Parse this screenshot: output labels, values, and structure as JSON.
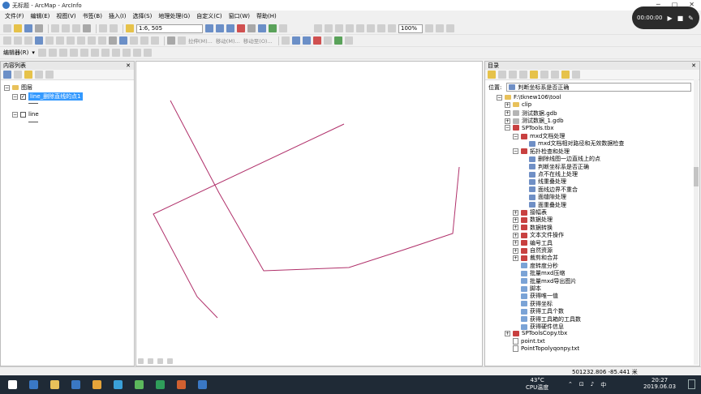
{
  "window": {
    "title": "无标题 - ArcMap - ArcInfo"
  },
  "menu": [
    "文件(F)",
    "编辑(E)",
    "视图(V)",
    "书签(B)",
    "插入(I)",
    "选择(S)",
    "地理处理(G)",
    "自定义(C)",
    "窗口(W)",
    "帮助(H)"
  ],
  "toolbar": {
    "scale_value": "1:6, 505",
    "zoom_value": "100%",
    "edit_tools": [
      "拉伸(M)...",
      "移动(M)...",
      "移动至(O)..."
    ],
    "editor_label": "编辑器(R)"
  },
  "recorder": {
    "time": "00:00:00"
  },
  "toc": {
    "title": "内容列表",
    "layers_root": "图层",
    "layers": [
      {
        "name": "line_删除直线的点1",
        "checked": true,
        "selected": true
      },
      {
        "name": "line",
        "checked": false,
        "selected": false
      }
    ]
  },
  "catalog": {
    "title": "目录",
    "location_label": "位置:",
    "location_value": "判断坐标系是否正确",
    "tree": [
      {
        "label": "F:\\tknew106\\tool",
        "icon": "folder",
        "level": 0,
        "expanded": true
      },
      {
        "label": "clip",
        "icon": "folder",
        "level": 1,
        "expanded": false
      },
      {
        "label": "测试数据.gdb",
        "icon": "gdb",
        "level": 1,
        "expanded": false
      },
      {
        "label": "测试数据_1.gdb",
        "icon": "gdb",
        "level": 1,
        "expanded": false
      },
      {
        "label": "SPTools.tbx",
        "icon": "tbx",
        "level": 1,
        "expanded": true
      },
      {
        "label": "mxd文档处理",
        "icon": "tbx",
        "level": 2,
        "expanded": true
      },
      {
        "label": "mxd文档相对路径和无效数据检查",
        "icon": "tool",
        "level": 3
      },
      {
        "label": "拓扑检查和处理",
        "icon": "tbx",
        "level": 2,
        "expanded": true
      },
      {
        "label": "删除线图一边直线上的点",
        "icon": "tool",
        "level": 3
      },
      {
        "label": "判断坐标系是否正确",
        "icon": "tool",
        "level": 3
      },
      {
        "label": "点不在线上处理",
        "icon": "tool",
        "level": 3
      },
      {
        "label": "线重叠处理",
        "icon": "tool",
        "level": 3
      },
      {
        "label": "面线边界不重合",
        "icon": "tool",
        "level": 3
      },
      {
        "label": "面缝隙处理",
        "icon": "tool",
        "level": 3
      },
      {
        "label": "面重叠处理",
        "icon": "tool",
        "level": 3
      },
      {
        "label": "接幅表",
        "icon": "tbx",
        "level": 2,
        "expanded": false
      },
      {
        "label": "数据处理",
        "icon": "tbx",
        "level": 2,
        "expanded": false
      },
      {
        "label": "数据转换",
        "icon": "tbx",
        "level": 2,
        "expanded": false
      },
      {
        "label": "文本文件操作",
        "icon": "tbx",
        "level": 2,
        "expanded": false
      },
      {
        "label": "编号工具",
        "icon": "tbx",
        "level": 2,
        "expanded": false
      },
      {
        "label": "自然资源",
        "icon": "tbx",
        "level": 2,
        "expanded": false
      },
      {
        "label": "裁剪和合并",
        "icon": "tbx",
        "level": 2,
        "expanded": false
      },
      {
        "label": "度转度分秒",
        "icon": "script",
        "level": 2
      },
      {
        "label": "批量mxd压缩",
        "icon": "script",
        "level": 2
      },
      {
        "label": "批量mxd导出图片",
        "icon": "script",
        "level": 2
      },
      {
        "label": "脚本",
        "icon": "script",
        "level": 2
      },
      {
        "label": "获得唯一值",
        "icon": "script",
        "level": 2
      },
      {
        "label": "获得坐标",
        "icon": "script",
        "level": 2
      },
      {
        "label": "获得工具个数",
        "icon": "script",
        "level": 2
      },
      {
        "label": "获得工具箱的工具数",
        "icon": "script",
        "level": 2
      },
      {
        "label": "获得硬件信息",
        "icon": "script",
        "level": 2
      },
      {
        "label": "SPToolsCopy.tbx",
        "icon": "tbx",
        "level": 1,
        "expanded": false
      },
      {
        "label": "point.txt",
        "icon": "txt",
        "level": 1
      },
      {
        "label": "PointTopolyqonpy.txt",
        "icon": "txt",
        "level": 1
      }
    ]
  },
  "status": {
    "coords": "501232.806  -85.441 米"
  },
  "taskbar": {
    "temperature": "43°C",
    "cpu_label": "CPU温度",
    "time": "20:27",
    "date": "2019.06.03"
  },
  "colors": {
    "line_color": "#b0306a",
    "selection": "#3399ff",
    "taskbar": "#1f2a36"
  }
}
